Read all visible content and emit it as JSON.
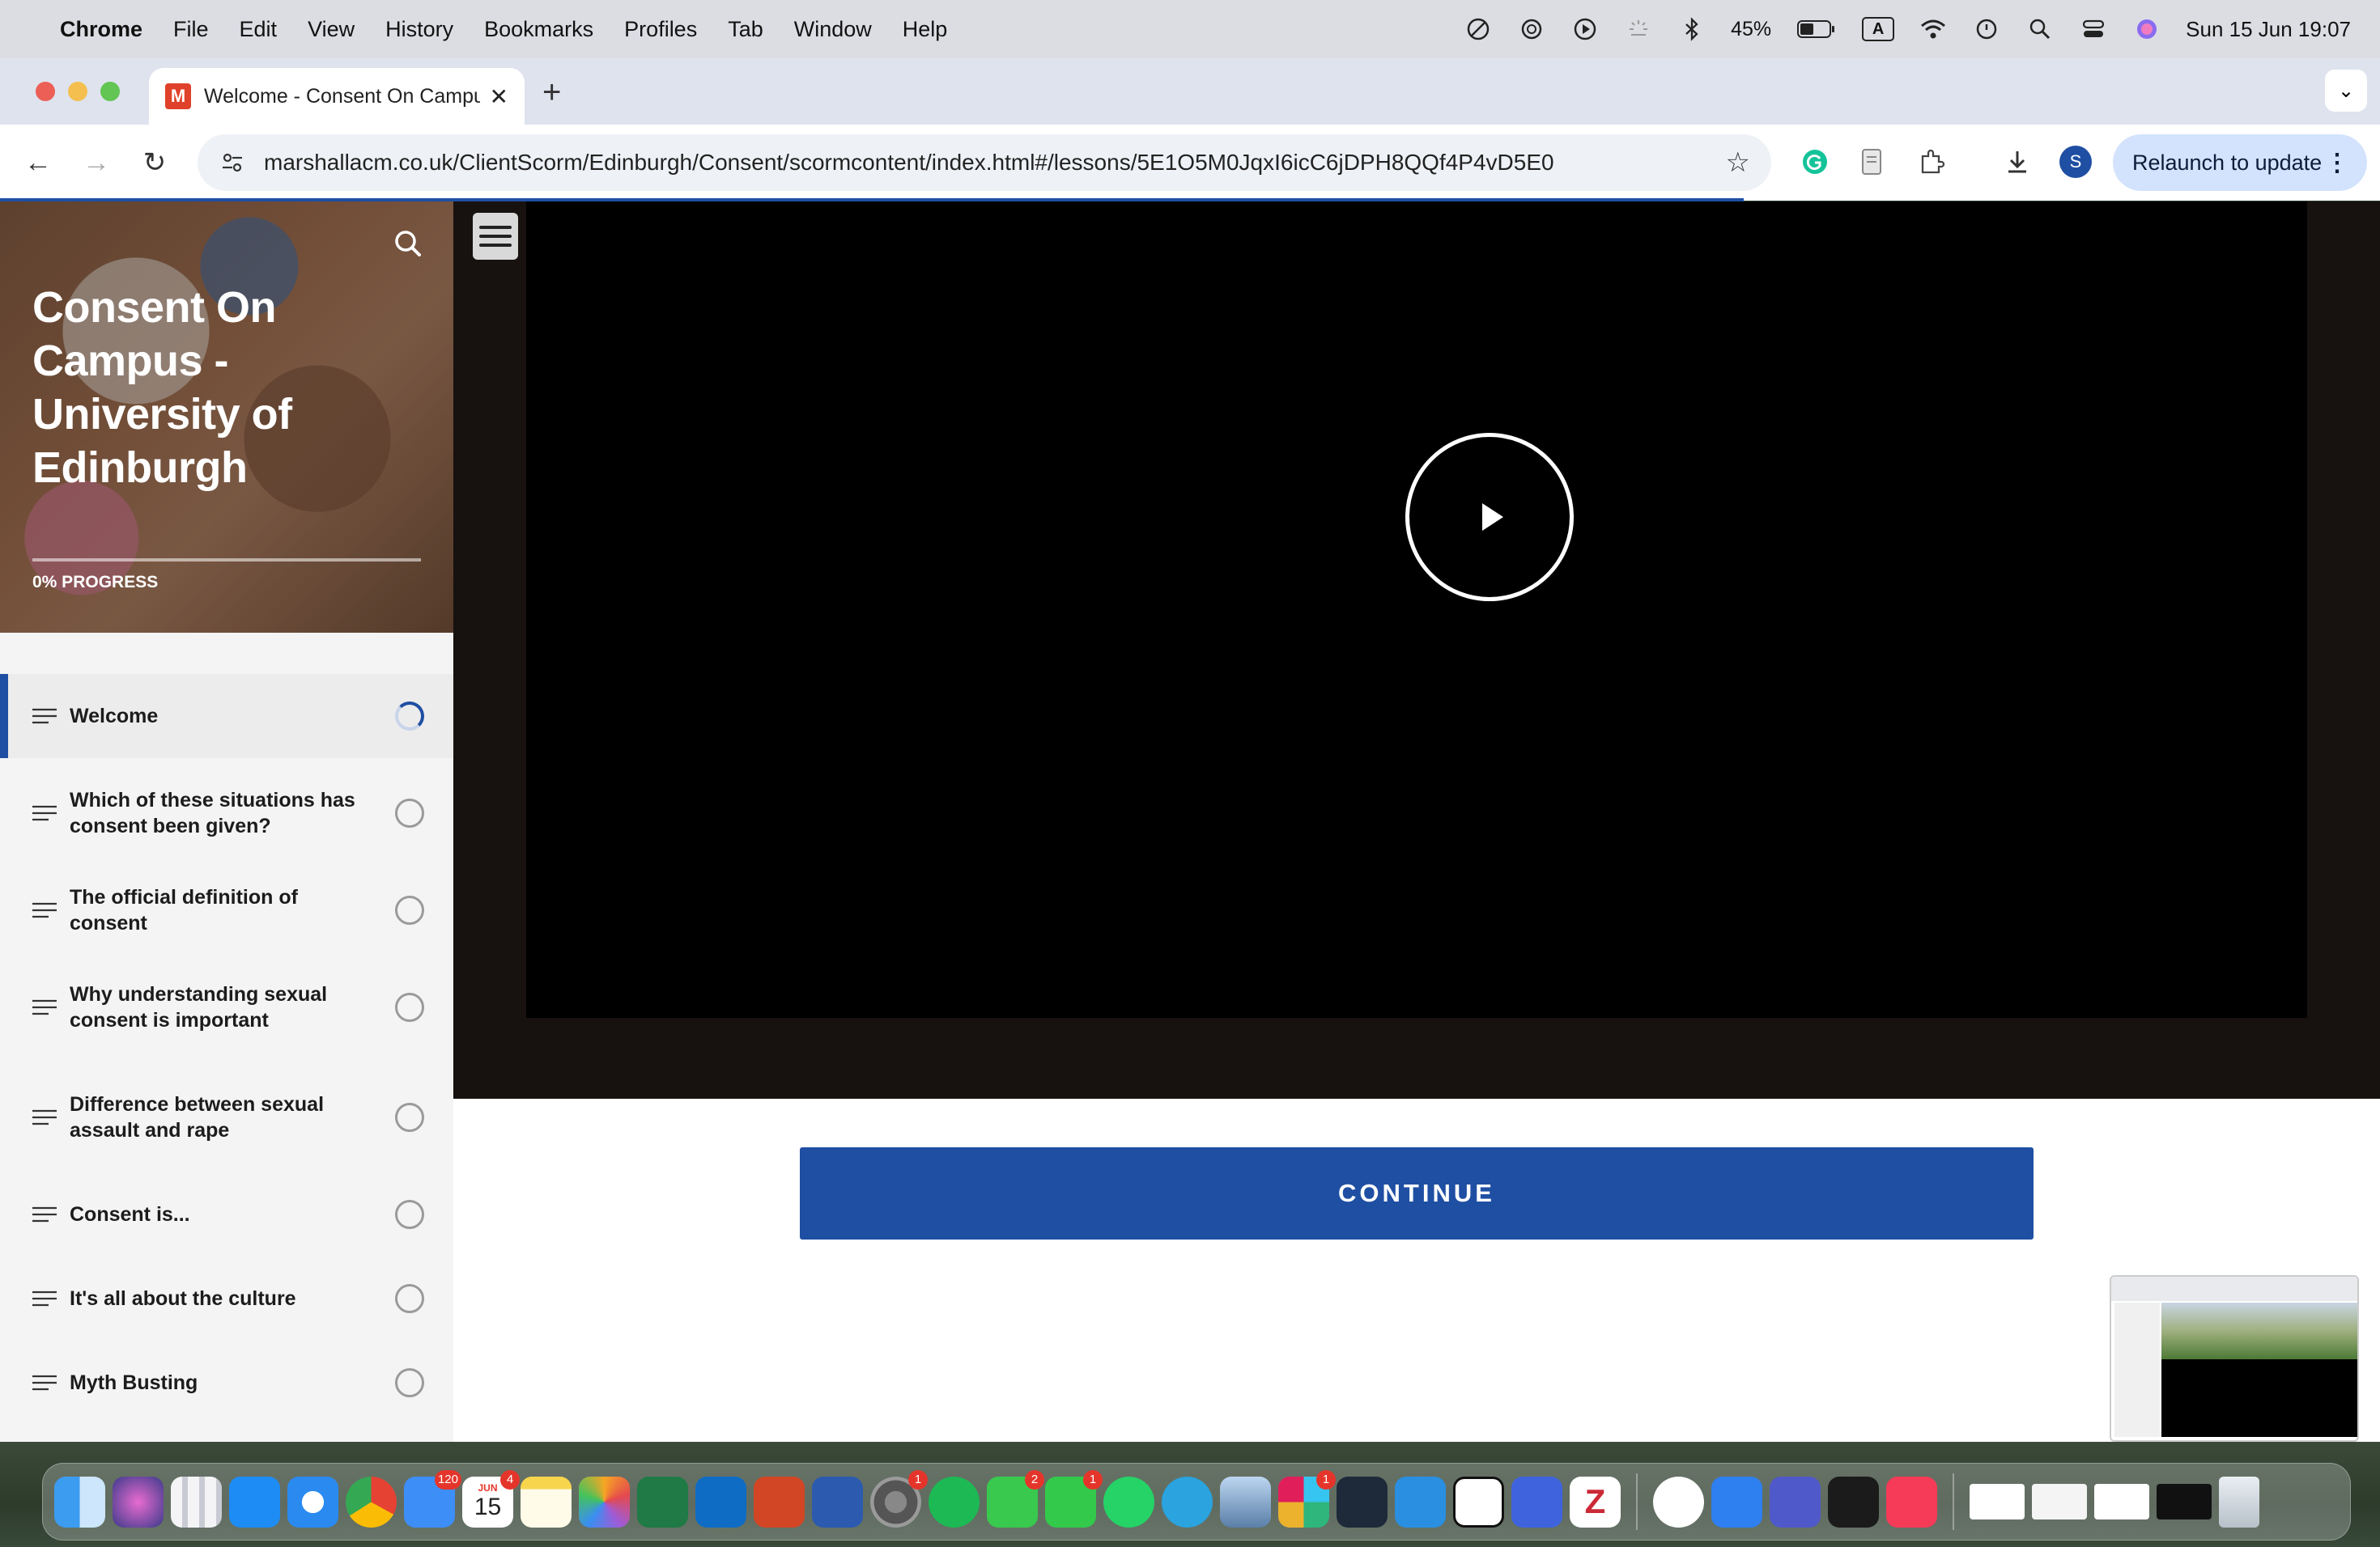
{
  "menubar": {
    "app_name": "Chrome",
    "items": [
      "File",
      "Edit",
      "View",
      "History",
      "Bookmarks",
      "Profiles",
      "Tab",
      "Window",
      "Help"
    ],
    "battery": "45%",
    "input_source": "A",
    "datetime": "Sun 15 Jun  19:07"
  },
  "browser": {
    "tab_title": "Welcome - Consent On Campus",
    "favicon_letter": "M",
    "url": "marshallacm.co.uk/ClientScorm/Edinburgh/Consent/scormcontent/index.html#/lessons/5E1O5M0JqxI6icC6jDPH8QQf4P4vD5E0",
    "profile_initial": "S",
    "relaunch_label": "Relaunch to update"
  },
  "course": {
    "title": "Consent On Campus - University of Edinburgh",
    "progress_percent": 0,
    "progress_label": "0% PROGRESS",
    "lessons": [
      {
        "label": "Welcome",
        "status": "in-progress",
        "active": true
      },
      {
        "label": "Which of these situations has consent been given?",
        "status": "not-started",
        "active": false
      },
      {
        "label": "The official definition of consent",
        "status": "not-started",
        "active": false
      },
      {
        "label": "Why understanding sexual consent is important",
        "status": "not-started",
        "active": false
      },
      {
        "label": "Difference between sexual assault and rape",
        "status": "not-started",
        "active": false
      },
      {
        "label": "Consent is...",
        "status": "not-started",
        "active": false
      },
      {
        "label": "It's all about the culture",
        "status": "not-started",
        "active": false
      },
      {
        "label": "Myth Busting",
        "status": "not-started",
        "active": false
      }
    ]
  },
  "main": {
    "continue_label": "CONTINUE"
  },
  "dock": {
    "calendar_month": "JUN",
    "calendar_day": "15",
    "mail_badge": "120",
    "calendar_badge": "4",
    "settings_badge": "1",
    "messages_badge": "2",
    "facetime_badge": "1",
    "slack_badge": "1"
  },
  "colors": {
    "accent": "#1f4fa3",
    "video_bg": "#000000",
    "media_band": "#17120f"
  }
}
